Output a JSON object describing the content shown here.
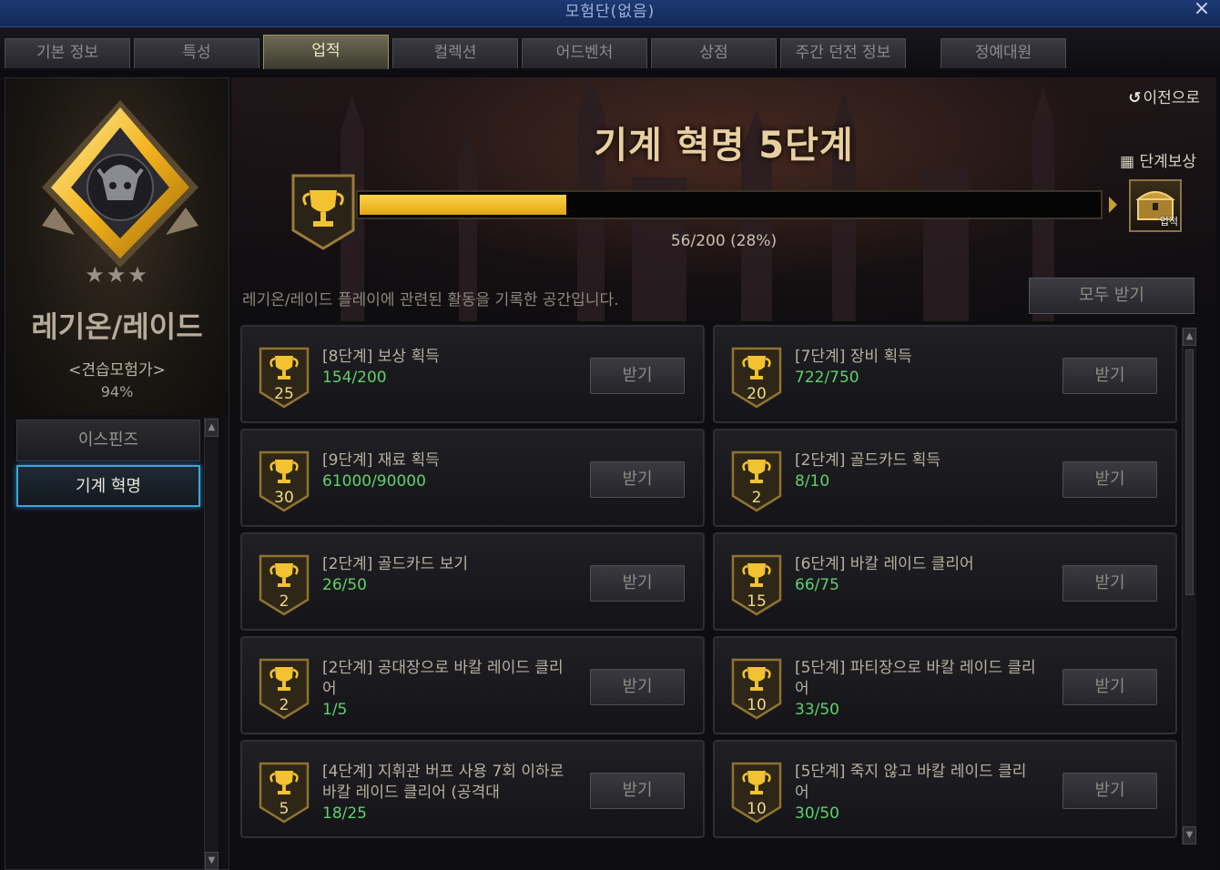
{
  "window": {
    "title": "모험단(없음)",
    "close": "×"
  },
  "tabs": [
    {
      "label": "기본 정보"
    },
    {
      "label": "특성"
    },
    {
      "label": "업적"
    },
    {
      "label": "컬렉션"
    },
    {
      "label": "어드벤처"
    },
    {
      "label": "상점"
    },
    {
      "label": "주간 던전 정보"
    },
    {
      "label": "정예대원"
    }
  ],
  "sidebar": {
    "stars": "★★★",
    "category_title": "레기온/레이드",
    "rank": "<견습모험가>",
    "percent": "94%",
    "items": [
      {
        "label": "이스핀즈"
      },
      {
        "label": "기계 혁명"
      }
    ]
  },
  "main": {
    "back_label": "이전으로",
    "stage_title": "기계 혁명 5단계",
    "stage_reward_label": "단계보상",
    "chest_label": "업적",
    "progress": {
      "current": 56,
      "total": 200,
      "percent": 28,
      "text": "56/200 (28%)"
    },
    "description": "레기온/레이드 플레이에 관련된 활동을 기록한 공간입니다.",
    "claim_all_label": "모두 받기",
    "claim_label": "받기",
    "achievements": [
      {
        "title": "[8단계] 보상 획득",
        "progress": "154/200",
        "points": "25"
      },
      {
        "title": "[7단계] 장비 획득",
        "progress": "722/750",
        "points": "20"
      },
      {
        "title": "[9단계] 재료 획득",
        "progress": "61000/90000",
        "points": "30"
      },
      {
        "title": "[2단계] 골드카드 획득",
        "progress": "8/10",
        "points": "2"
      },
      {
        "title": "[2단계] 골드카드 보기",
        "progress": "26/50",
        "points": "2"
      },
      {
        "title": "[6단계] 바칼 레이드 클리어",
        "progress": "66/75",
        "points": "15"
      },
      {
        "title": "[2단계] 공대장으로 바칼 레이드 클리어",
        "progress": "1/5",
        "points": "2"
      },
      {
        "title": "[5단계] 파티장으로 바칼 레이드 클리어",
        "progress": "33/50",
        "points": "10"
      },
      {
        "title": "[4단계] 지휘관 버프 사용 7회 이하로 바칼 레이드 클리어 (공격대",
        "progress": "18/25",
        "points": "5"
      },
      {
        "title": "[5단계] 죽지 않고 바칼 레이드 클리어",
        "progress": "30/50",
        "points": "10"
      }
    ]
  },
  "colors": {
    "accent_gold": "#f2c230",
    "progress_green": "#5fd16a",
    "selected_blue": "#3ba6d8"
  },
  "icons": {
    "trophy": "trophy-icon",
    "chest": "treasure-chest-icon",
    "back": "back-arrow-icon",
    "gift": "gift-icon"
  }
}
